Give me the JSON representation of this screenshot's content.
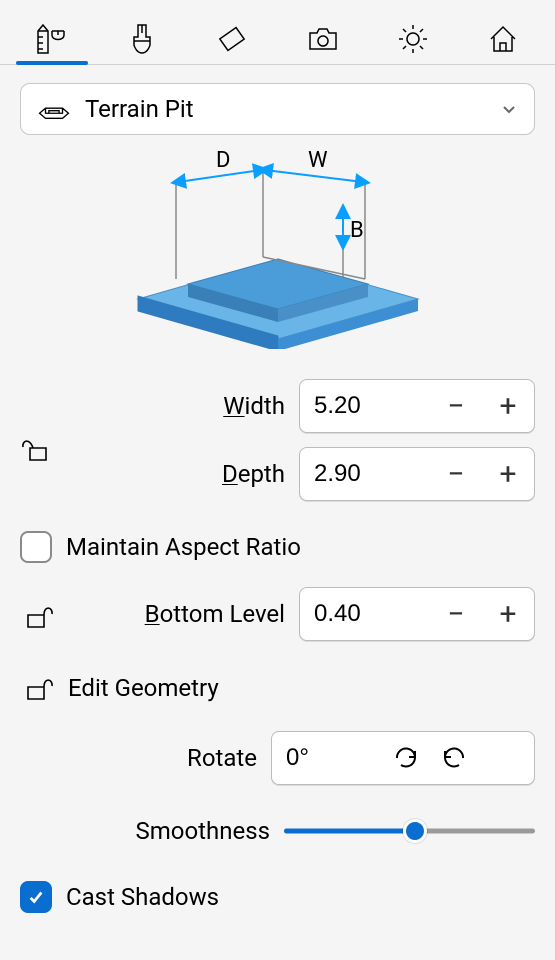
{
  "tabs": {
    "measure": "measure",
    "brush": "brush",
    "eraser": "eraser",
    "camera": "camera",
    "sun": "sun",
    "house": "house"
  },
  "selector": {
    "label": "Terrain Pit"
  },
  "diagram": {
    "d_label": "D",
    "w_label": "W",
    "b_label": "B"
  },
  "width": {
    "label_pre": "",
    "label_ul": "W",
    "label_post": "idth",
    "value": "5.20"
  },
  "depth": {
    "label_pre": "",
    "label_ul": "D",
    "label_post": "epth",
    "value": "2.90"
  },
  "maintain": {
    "label": "Maintain Aspect Ratio",
    "checked": false
  },
  "bottom": {
    "label_pre": "",
    "label_ul": "B",
    "label_post": "ottom Level",
    "value": "0.40"
  },
  "edit_geometry": {
    "label": "Edit Geometry"
  },
  "rotate": {
    "label": "Rotate",
    "value": "0°"
  },
  "smoothness": {
    "label": "Smoothness",
    "percent": 52
  },
  "cast_shadows": {
    "label": "Cast Shadows",
    "checked": true
  },
  "buttons": {
    "minus": "−",
    "plus": "+"
  }
}
